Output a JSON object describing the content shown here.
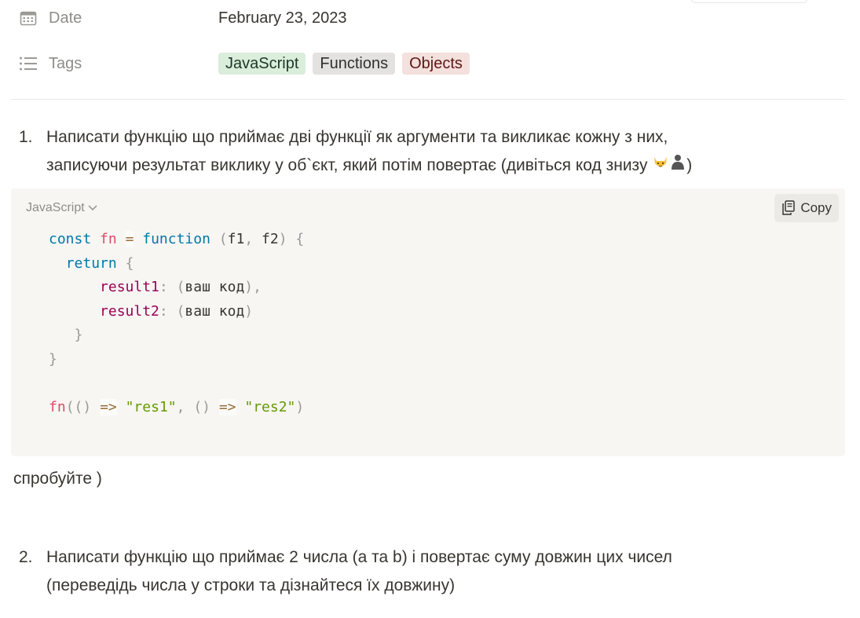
{
  "properties": {
    "date": {
      "label": "Date",
      "value": "February 23, 2023",
      "icon": "calendar-icon"
    },
    "tags": {
      "label": "Tags",
      "icon": "list-icon",
      "values": [
        {
          "text": "JavaScript",
          "bg": "#dbeddb",
          "fg": "#1c3829"
        },
        {
          "text": "Functions",
          "bg": "#e3e2e0",
          "fg": "#32302c"
        },
        {
          "text": "Objects",
          "bg": "#f4e0dc",
          "fg": "#5d1715"
        }
      ]
    }
  },
  "item1": {
    "number": "1.",
    "line1": "Написати функцію що приймає дві функції як аргументи та викликає кожну з них,",
    "line2": "записуючи результат виклику у об`єкт, який потім повертає (дивіться код знизу ",
    "line2_end": ")",
    "emojis": [
      "cat-face-icon",
      "person-silhouette-icon"
    ]
  },
  "code": {
    "language": "JavaScript",
    "copy_label": "Copy",
    "lines": [
      "const fn = function (f1, f2) {",
      "  return {",
      "      result1: (ваш код),",
      "      result2: (ваш код)",
      "   }",
      "}",
      "",
      "fn(() => \"res1\", () => \"res2\")"
    ]
  },
  "paragraph": "спробуйте )",
  "item2": {
    "number": "2.",
    "line1": "Написати функцію що приймає 2 числа (a та b) і повертає суму довжин цих чисел",
    "line2": "(переведідь числа у строки та дізнайтеся їх довжину)"
  }
}
